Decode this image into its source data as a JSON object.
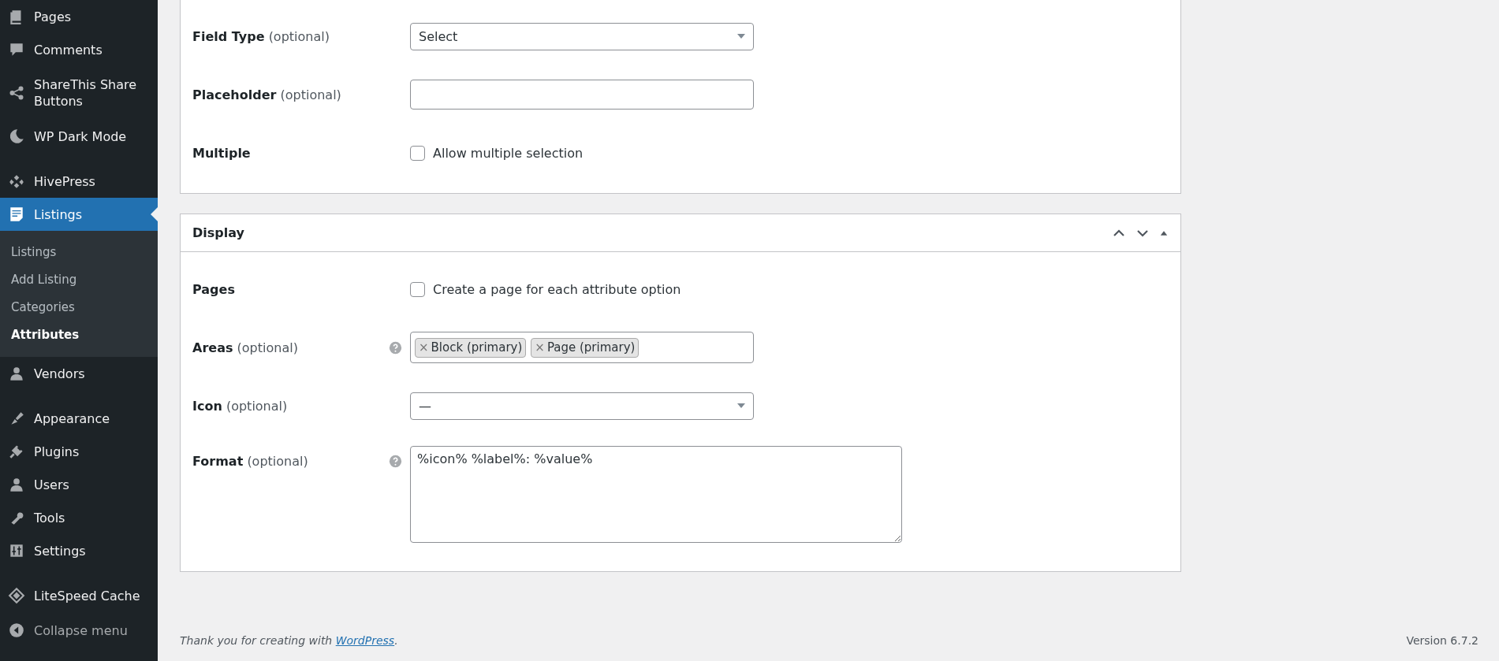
{
  "sidebar": {
    "groups": [
      [
        {
          "label": "Pages",
          "selected": false
        },
        {
          "label": "Comments",
          "selected": false
        },
        {
          "label": "ShareThis Share Buttons",
          "selected": false
        },
        {
          "label": "WP Dark Mode",
          "selected": false
        }
      ],
      [
        {
          "label": "HivePress",
          "selected": false
        },
        {
          "label": "Listings",
          "selected": true,
          "children": [
            {
              "label": "Listings",
              "selected": false
            },
            {
              "label": "Add Listing",
              "selected": false
            },
            {
              "label": "Categories",
              "selected": false
            },
            {
              "label": "Attributes",
              "selected": true
            }
          ]
        },
        {
          "label": "Vendors",
          "selected": false
        }
      ],
      [
        {
          "label": "Appearance",
          "selected": false
        },
        {
          "label": "Plugins",
          "selected": false
        },
        {
          "label": "Users",
          "selected": false
        },
        {
          "label": "Tools",
          "selected": false
        },
        {
          "label": "Settings",
          "selected": false
        }
      ],
      [
        {
          "label": "LiteSpeed Cache",
          "selected": false
        }
      ]
    ],
    "collapse": "Collapse menu"
  },
  "panels": [
    {
      "fields": [
        {
          "kind": "select",
          "label": "Field Type",
          "note": "(optional)",
          "help": false,
          "value": "Select"
        },
        {
          "kind": "text",
          "label": "Placeholder",
          "note": "(optional)",
          "help": false
        },
        {
          "kind": "checkbox",
          "label": "Multiple",
          "help": false,
          "checked": false,
          "option": "Allow multiple selection"
        }
      ]
    },
    {
      "title": "Display",
      "fields": [
        {
          "kind": "checkbox",
          "label": "Pages",
          "help": false,
          "checked": false,
          "option": "Create a page for each attribute option"
        },
        {
          "kind": "tags",
          "label": "Areas",
          "note": "(optional)",
          "help": true,
          "tags": [
            {
              "remove": "×",
              "label": "Block (primary)"
            },
            {
              "remove": "×",
              "label": "Page (primary)"
            }
          ]
        },
        {
          "kind": "select",
          "label": "Icon",
          "note": "(optional)",
          "help": false,
          "value": "—"
        },
        {
          "kind": "textarea",
          "label": "Format",
          "note": "(optional)",
          "help": true,
          "value": "%icon% %label%: %value%"
        }
      ]
    }
  ],
  "footer": {
    "text": "Thank you for creating with",
    "link": "WordPress",
    "end": ".",
    "version": "Version 6.7.2"
  }
}
